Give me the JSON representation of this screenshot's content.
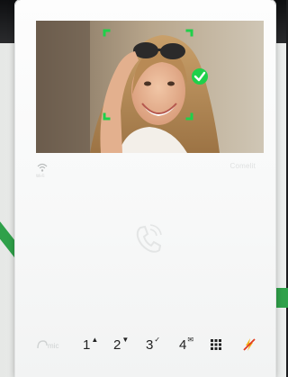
{
  "brand": "Comelit",
  "wifi_label": "Wi-Fi",
  "face_check": "verified-check-icon",
  "mic_label": "mic",
  "keys": [
    {
      "num": "1",
      "sym": "▲"
    },
    {
      "num": "2",
      "sym": "▼"
    },
    {
      "num": "3",
      "sym": "✓"
    },
    {
      "num": "4",
      "sym": "✉"
    }
  ],
  "colors": {
    "face_frame": "#1fd04a",
    "check_bg": "#1fd04a",
    "device_body": "#f7f8f8",
    "accent_red": "#e23a1e",
    "accent_yellow": "#f2b51c"
  }
}
